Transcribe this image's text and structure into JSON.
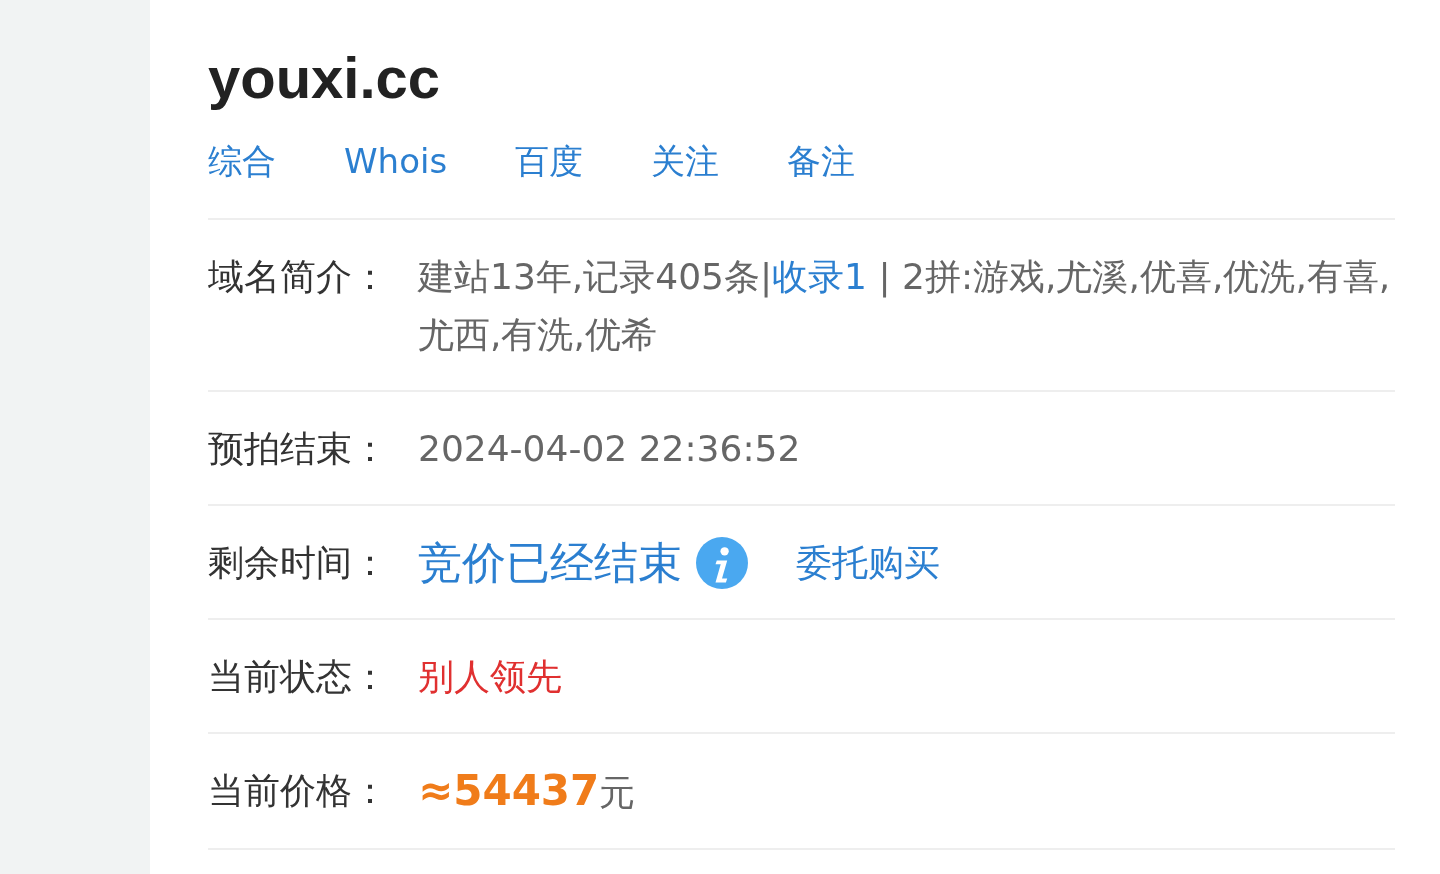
{
  "domain": "youxi.cc",
  "tabs": [
    {
      "label": "综合"
    },
    {
      "label": "Whois"
    },
    {
      "label": "百度"
    },
    {
      "label": "关注"
    },
    {
      "label": "备注"
    }
  ],
  "rows": [
    {
      "kind": "intro",
      "label": "域名简介：",
      "before": "建站13年,记录405条|",
      "link": "收录1",
      "after": " | 2拼:游戏,尤溪,优喜,优洗,有喜,尤西,有洗,优希"
    },
    {
      "kind": "text",
      "label": "预拍结束：",
      "value": "2024-04-02 22:36:52"
    },
    {
      "kind": "remaining",
      "label": "剩余时间：",
      "value": "竞价已经结束",
      "link": "委托购买"
    },
    {
      "kind": "status",
      "label": "当前状态：",
      "value": "别人领先"
    },
    {
      "kind": "price",
      "label": "当前价格：",
      "amount": "≈54437",
      "unit": "元"
    }
  ]
}
